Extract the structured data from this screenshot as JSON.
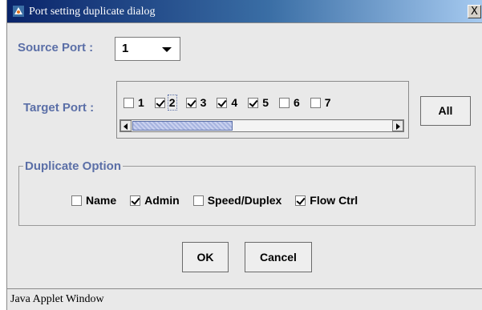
{
  "window": {
    "title": "Port setting duplicate dialog",
    "close_label": "X"
  },
  "source_port": {
    "label": "Source Port :",
    "value": "1"
  },
  "target_port": {
    "label": "Target Port :",
    "ports": [
      {
        "label": "1",
        "checked": false
      },
      {
        "label": "2",
        "checked": true
      },
      {
        "label": "3",
        "checked": true
      },
      {
        "label": "4",
        "checked": true
      },
      {
        "label": "5",
        "checked": true
      },
      {
        "label": "6",
        "checked": false
      },
      {
        "label": "7",
        "checked": false
      }
    ],
    "all_label": "All"
  },
  "duplicate_option": {
    "legend": "Duplicate Option",
    "options": [
      {
        "label": "Name",
        "checked": false
      },
      {
        "label": "Admin",
        "checked": true
      },
      {
        "label": "Speed/Duplex",
        "checked": false
      },
      {
        "label": "Flow Ctrl",
        "checked": true
      }
    ]
  },
  "buttons": {
    "ok": "OK",
    "cancel": "Cancel"
  },
  "status_bar": {
    "text": "Java Applet Window"
  }
}
